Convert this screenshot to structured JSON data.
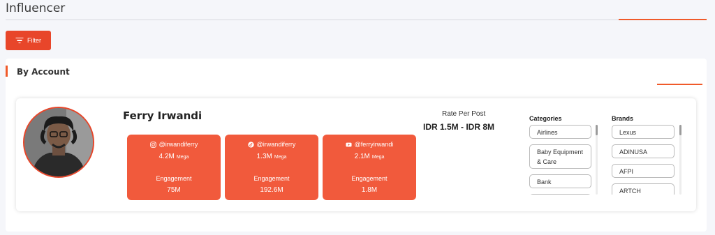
{
  "page": {
    "title": "Influencer"
  },
  "toolbar": {
    "filter_label": "Filter"
  },
  "section": {
    "title": "By Account"
  },
  "profile": {
    "name": "Ferry Irwandi",
    "platforms": [
      {
        "icon": "instagram-icon",
        "handle": "@irwandiferry",
        "followers": "4.2M",
        "tier": "Mega",
        "engagement_label": "Engagement",
        "engagement": "75M"
      },
      {
        "icon": "tiktok-icon",
        "handle": "@irwandiferry",
        "followers": "1.3M",
        "tier": "Mega",
        "engagement_label": "Engagement",
        "engagement": "192.6M"
      },
      {
        "icon": "youtube-icon",
        "handle": "@ferryirwandi",
        "followers": "2.1M",
        "tier": "Mega",
        "engagement_label": "Engagement",
        "engagement": "1.8M"
      }
    ],
    "rate": {
      "label": "Rate Per Post",
      "value": "IDR 1.5M - IDR 8M"
    },
    "categories": {
      "title": "Categories",
      "items": [
        "Airlines",
        "Baby Equipment & Care",
        "Bank"
      ]
    },
    "brands": {
      "title": "Brands",
      "items": [
        "Lexus",
        "ADINUSA",
        "AFPI",
        "ARTCH"
      ]
    }
  },
  "colors": {
    "accent": "#e8462a",
    "stat_box": "#f15a3c"
  }
}
